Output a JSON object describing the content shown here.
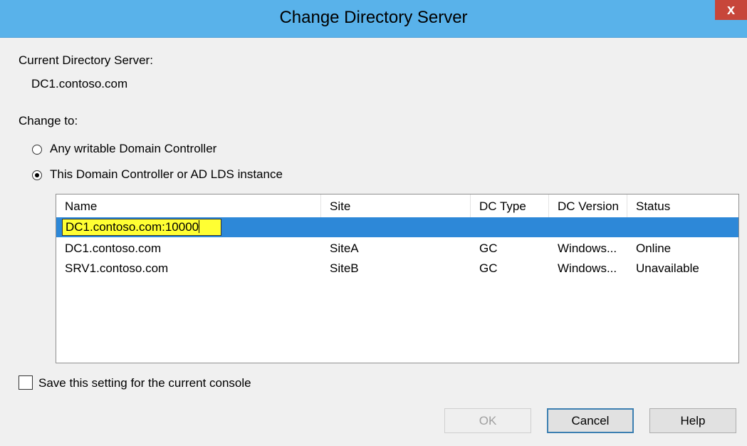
{
  "window": {
    "title": "Change Directory Server",
    "close_glyph": "x"
  },
  "current": {
    "label": "Current Directory Server:",
    "value": "DC1.contoso.com"
  },
  "change_to": {
    "label": "Change to:",
    "options": [
      {
        "label": "Any writable Domain Controller",
        "checked": false
      },
      {
        "label": "This Domain Controller or AD LDS instance",
        "checked": true
      }
    ]
  },
  "table": {
    "columns": [
      "Name",
      "Site",
      "DC Type",
      "DC Version",
      "Status"
    ],
    "editing_value": "DC1.contoso.com:10000",
    "rows": [
      {
        "name": "DC1.contoso.com",
        "site": "SiteA",
        "dc_type": "GC",
        "dc_version": "Windows...",
        "status": "Online"
      },
      {
        "name": "SRV1.contoso.com",
        "site": "SiteB",
        "dc_type": "GC",
        "dc_version": "Windows...",
        "status": "Unavailable"
      }
    ]
  },
  "save_setting": {
    "label": "Save this setting for the current console",
    "checked": false
  },
  "buttons": {
    "ok": "OK",
    "cancel": "Cancel",
    "help": "Help"
  },
  "colors": {
    "titlebar": "#59b2ea",
    "selection": "#2d88d8",
    "highlight": "#ffff33",
    "close": "#c7463a"
  },
  "icons": {
    "close": "close-icon",
    "caret": "text-caret-icon"
  }
}
